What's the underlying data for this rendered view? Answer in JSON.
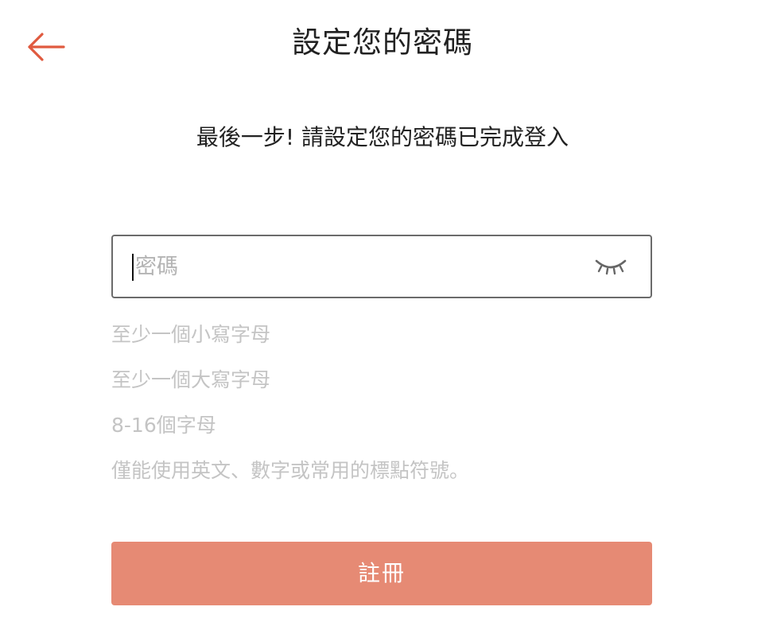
{
  "header": {
    "title": "設定您的密碼",
    "back_icon": "arrow-left-icon"
  },
  "subtitle": "最後一步! 請設定您的密碼已完成登入",
  "password_field": {
    "placeholder": "密碼",
    "value": "",
    "toggle_icon": "eye-closed-icon"
  },
  "rules": [
    {
      "label": "至少一個小寫字母"
    },
    {
      "label": "至少一個大寫字母"
    },
    {
      "label": "8-16個字母"
    },
    {
      "label": "僅能使用英文、數字或常用的標點符號。"
    }
  ],
  "register_button": {
    "label": "註冊"
  },
  "colors": {
    "accent": "#e05a3f",
    "button": "#e68a74",
    "rule_text": "#c4c4c4"
  }
}
